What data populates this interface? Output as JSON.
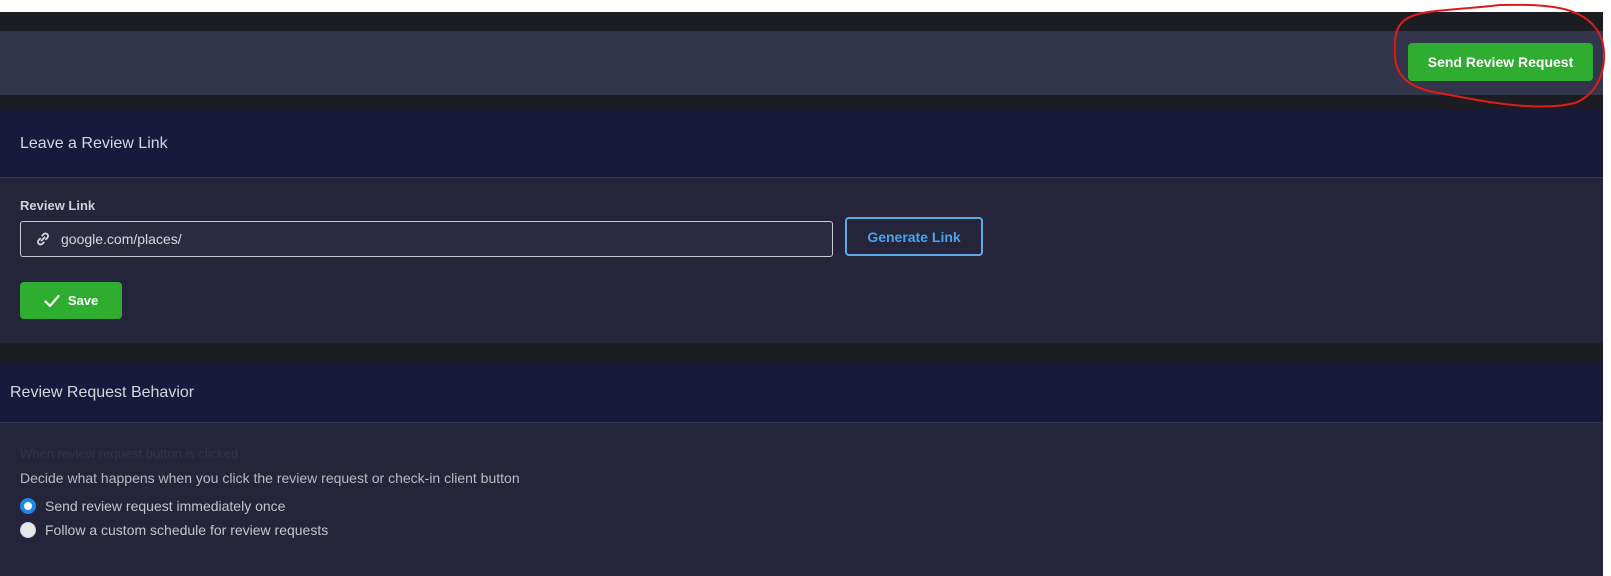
{
  "header": {
    "send_review_request_label": "Send Review Request"
  },
  "review_link_card": {
    "title": "Leave a Review Link",
    "field_label": "Review Link",
    "input_value": "google.com/places/",
    "generate_link_label": "Generate Link",
    "save_label": "Save"
  },
  "behavior_card": {
    "title": "Review Request Behavior",
    "faded_label": "When review request button is clicked",
    "description": "Decide what happens when you click the review request or check-in client button",
    "options": [
      {
        "label": "Send review request immediately once",
        "selected": true
      },
      {
        "label": "Follow a custom schedule for review requests",
        "selected": false
      }
    ]
  },
  "icons": [
    "link-icon",
    "check-icon"
  ],
  "colors": {
    "accent_green": "#2fad30",
    "accent_blue": "#4aa3ea",
    "annotation_red": "#e01b1b"
  }
}
